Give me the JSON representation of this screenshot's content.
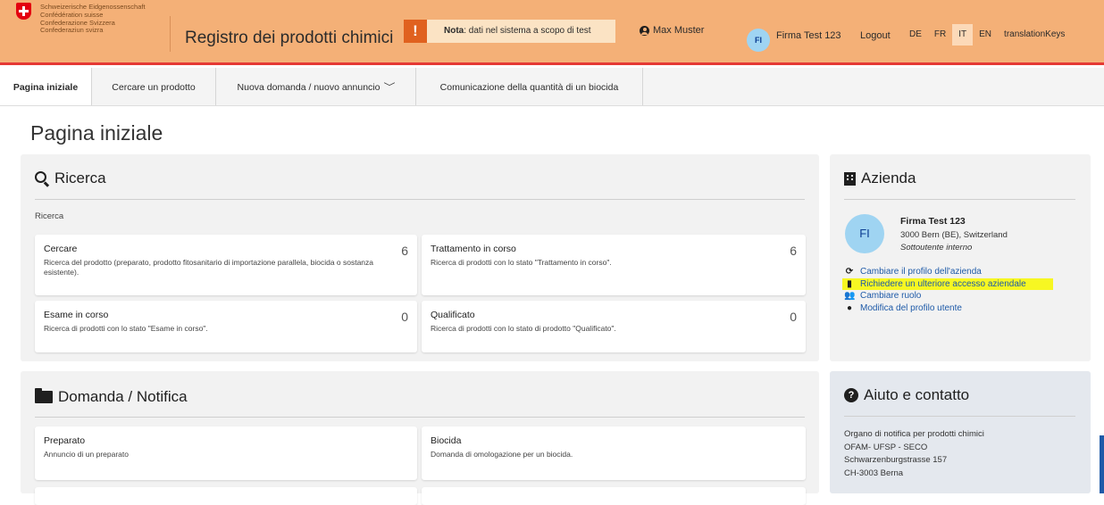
{
  "header": {
    "confederation": [
      "Schweizerische Eidgenossenschaft",
      "Confédération suisse",
      "Confederazione Svizzera",
      "Confederaziun svizra"
    ],
    "app_title": "Registro dei prodotti chimici",
    "note_icon": "!",
    "note_label": "Nota",
    "note_text": ": dati nel sistema a scopo di test",
    "user_name": "Max Muster",
    "firm_initials": "FI",
    "firm_name": "Firma Test 123",
    "logout": "Logout",
    "languages": [
      "DE",
      "FR",
      "IT",
      "EN",
      "translationKeys"
    ],
    "active_language": "IT",
    "colors": {
      "header_bg": "#f4b077",
      "accent_red": "#e53935",
      "note_bg": "#fbe3c4",
      "note_icon_bg": "#e0611f"
    }
  },
  "nav": {
    "items": [
      "Pagina iniziale",
      "Cercare un prodotto",
      "Nuova domanda / nuovo annuncio",
      "Comunicazione della quantità di un biocida"
    ],
    "active": "Pagina iniziale"
  },
  "page": {
    "title": "Pagina iniziale"
  },
  "ricerca": {
    "title": "Ricerca",
    "subtitle": "Ricerca",
    "cards": [
      {
        "title": "Cercare",
        "count": "6",
        "desc": "Ricerca del prodotto (preparato, prodotto fitosanitario di importazione parallela, biocida o sostanza esistente)."
      },
      {
        "title": "Trattamento in corso",
        "count": "6",
        "desc": "Ricerca di prodotti con lo stato \"Trattamento in corso\"."
      },
      {
        "title": "Esame in corso",
        "count": "0",
        "desc": "Ricerca di prodotti con lo stato \"Esame in corso\"."
      },
      {
        "title": "Qualificato",
        "count": "0",
        "desc": "Ricerca di prodotti con lo stato di prodotto \"Qualificato\"."
      }
    ]
  },
  "domanda": {
    "title": "Domanda / Notifica",
    "cards": [
      {
        "title": "Preparato",
        "desc": "Annuncio di un preparato"
      },
      {
        "title": "Biocida",
        "desc": "Domanda di omologazione per un biocida."
      }
    ]
  },
  "azienda": {
    "title": "Azienda",
    "initials": "FI",
    "name": "Firma Test 123",
    "address": "3000 Bern (BE), Switzerland",
    "role": "Sottoutente interno",
    "links": [
      {
        "label": "Cambiare il profilo dell'azienda",
        "icon": "sync-icon"
      },
      {
        "label": "Richiedere un ulteriore accesso aziendale",
        "icon": "building-icon",
        "highlight": "#f7f722"
      },
      {
        "label": "Cambiare ruolo",
        "icon": "users-icon"
      },
      {
        "label": "Modifica del profilo utente",
        "icon": "user-circle-icon"
      }
    ]
  },
  "aiuto": {
    "title": "Aiuto e contatto",
    "lines": [
      "Organo di notifica per prodotti chimici",
      "OFAM- UFSP - SECO",
      "Schwarzenburgstrasse 157",
      "CH-3003 Berna"
    ]
  }
}
